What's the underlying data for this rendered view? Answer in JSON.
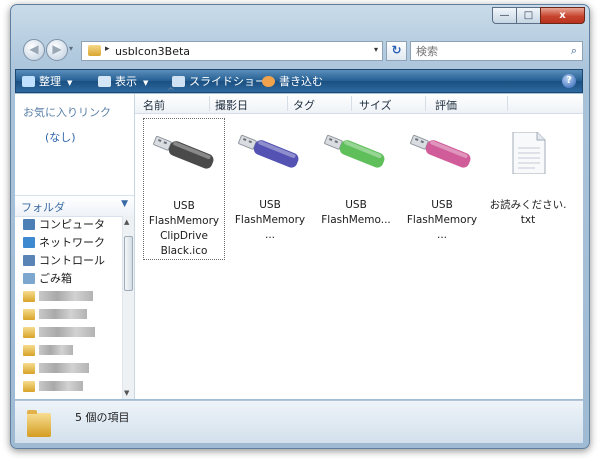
{
  "window": {
    "controls": {
      "min": "—",
      "max": "□",
      "close": "x"
    }
  },
  "address": {
    "separator": "▸",
    "path": "usbIcon3Beta",
    "refresh": "↻"
  },
  "search": {
    "placeholder": "検索"
  },
  "toolbar": {
    "items": [
      {
        "label": "整理",
        "color": "#bfe0ff"
      },
      {
        "label": "表示",
        "color": "#d4e6f5"
      },
      {
        "label": "スライドショー",
        "color": "#cfe2f4"
      },
      {
        "label": "書き込む",
        "color": "#f1a24d"
      }
    ],
    "help": "?"
  },
  "nav_pane": {
    "favorites_title": "お気に入りリンク",
    "favorites_empty": "(なし)",
    "folders_label": "フォルダ",
    "tree": [
      {
        "label": "コンピュータ",
        "icon": "computer-icon",
        "color": "#4c7fb5"
      },
      {
        "label": "ネットワーク",
        "icon": "network-icon",
        "color": "#3d8ad0"
      },
      {
        "label": "コントロール",
        "icon": "control-panel-icon",
        "color": "#5b84b6"
      },
      {
        "label": "ごみ箱",
        "icon": "recycle-bin-icon",
        "color": "#7ea7cf"
      }
    ]
  },
  "columns": [
    "名前",
    "撮影日",
    "タグ",
    "サイズ",
    "評価"
  ],
  "files": [
    {
      "name": "USB\nFlashMemory\nClipDrive\nBlack.ico",
      "body": "#4a4a4a",
      "selected": true
    },
    {
      "name": "USB\nFlashMemory ...",
      "body": "#5452b3",
      "selected": false
    },
    {
      "name": "USB\nFlashMemo...",
      "body": "#5fbf5b",
      "selected": false
    },
    {
      "name": "USB\nFlashMemory ...",
      "body": "#d05c9a",
      "selected": false
    },
    {
      "name": "お読みください.\ntxt",
      "body": "",
      "selected": false
    }
  ],
  "status": {
    "text": "5 個の項目"
  }
}
